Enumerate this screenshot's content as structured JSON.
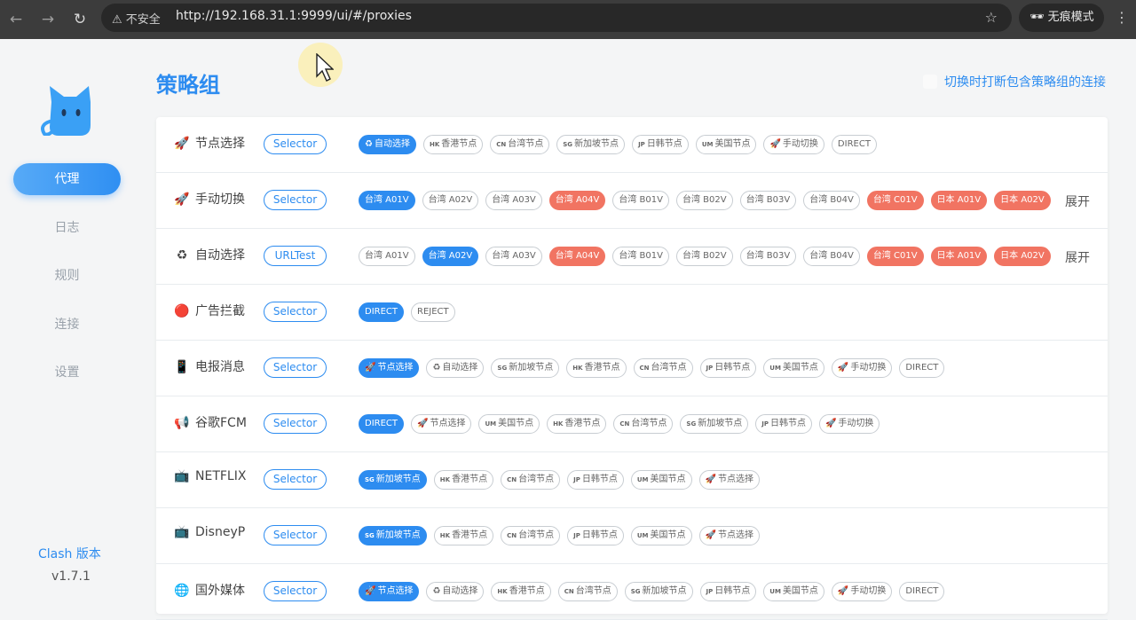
{
  "browser": {
    "security": "不安全",
    "url": "http://192.168.31.1:9999/ui/#/proxies",
    "incognito": "无痕模式"
  },
  "sidebar": {
    "items": [
      {
        "label": "代理"
      },
      {
        "label": "日志"
      },
      {
        "label": "规则"
      },
      {
        "label": "连接"
      },
      {
        "label": "设置"
      }
    ],
    "version_label": "Clash 版本",
    "version": "v1.7.1"
  },
  "page": {
    "title": "策略组",
    "disconnect_option": "切换时打断包含策略组的连接"
  },
  "colors": {
    "accent": "#2d8cf0",
    "timeout": "#f17462"
  },
  "groups": [
    {
      "name": "节点选择",
      "icon": "rocket-icon",
      "type": "Selector",
      "proxies": [
        {
          "label": "自动选择",
          "icon": "recycle-icon",
          "state": "selected"
        },
        {
          "flag": "HK",
          "label": "香港节点"
        },
        {
          "flag": "CN",
          "label": "台湾节点"
        },
        {
          "flag": "SG",
          "label": "新加坡节点"
        },
        {
          "flag": "JP",
          "label": "日韩节点"
        },
        {
          "flag": "UM",
          "label": "美国节点"
        },
        {
          "icon": "rocket-icon",
          "label": "手动切换"
        },
        {
          "label": "DIRECT"
        }
      ]
    },
    {
      "name": "手动切换",
      "icon": "rocket-icon",
      "type": "Selector",
      "expand": "展开",
      "proxies": [
        {
          "label": "台湾 A01V",
          "state": "selected"
        },
        {
          "label": "台湾 A02V"
        },
        {
          "label": "台湾 A03V"
        },
        {
          "label": "台湾 A04V",
          "state": "timeout"
        },
        {
          "label": "台湾 B01V"
        },
        {
          "label": "台湾 B02V"
        },
        {
          "label": "台湾 B03V"
        },
        {
          "label": "台湾 B04V"
        },
        {
          "label": "台湾 C01V",
          "state": "timeout"
        },
        {
          "label": "日本 A01V",
          "state": "timeout"
        },
        {
          "label": "日本 A02V",
          "state": "timeout"
        }
      ]
    },
    {
      "name": "自动选择",
      "icon": "recycle-icon",
      "type": "URLTest",
      "expand": "展开",
      "proxies": [
        {
          "label": "台湾 A01V"
        },
        {
          "label": "台湾 A02V",
          "state": "selected"
        },
        {
          "label": "台湾 A03V"
        },
        {
          "label": "台湾 A04V",
          "state": "timeout"
        },
        {
          "label": "台湾 B01V"
        },
        {
          "label": "台湾 B02V"
        },
        {
          "label": "台湾 B03V"
        },
        {
          "label": "台湾 B04V"
        },
        {
          "label": "台湾 C01V",
          "state": "timeout"
        },
        {
          "label": "日本 A01V",
          "state": "timeout"
        },
        {
          "label": "日本 A02V",
          "state": "timeout"
        }
      ]
    },
    {
      "name": "广告拦截",
      "icon": "stop-icon",
      "type": "Selector",
      "proxies": [
        {
          "label": "DIRECT",
          "state": "selected"
        },
        {
          "label": "REJECT"
        }
      ]
    },
    {
      "name": "电报消息",
      "icon": "phone-icon",
      "type": "Selector",
      "proxies": [
        {
          "icon": "rocket-icon",
          "label": "节点选择",
          "state": "selected"
        },
        {
          "icon": "recycle-icon",
          "label": "自动选择"
        },
        {
          "flag": "SG",
          "label": "新加坡节点"
        },
        {
          "flag": "HK",
          "label": "香港节点"
        },
        {
          "flag": "CN",
          "label": "台湾节点"
        },
        {
          "flag": "JP",
          "label": "日韩节点"
        },
        {
          "flag": "UM",
          "label": "美国节点"
        },
        {
          "icon": "rocket-icon",
          "label": "手动切换"
        },
        {
          "label": "DIRECT"
        }
      ]
    },
    {
      "name": "谷歌FCM",
      "icon": "megaphone-icon",
      "type": "Selector",
      "proxies": [
        {
          "label": "DIRECT",
          "state": "selected"
        },
        {
          "icon": "rocket-icon",
          "label": "节点选择"
        },
        {
          "flag": "UM",
          "label": "美国节点"
        },
        {
          "flag": "HK",
          "label": "香港节点"
        },
        {
          "flag": "CN",
          "label": "台湾节点"
        },
        {
          "flag": "SG",
          "label": "新加坡节点"
        },
        {
          "flag": "JP",
          "label": "日韩节点"
        },
        {
          "icon": "rocket-icon",
          "label": "手动切换"
        }
      ]
    },
    {
      "name": "NETFLIX",
      "icon": "tv-icon",
      "type": "Selector",
      "proxies": [
        {
          "flag": "SG",
          "label": "新加坡节点",
          "state": "selected"
        },
        {
          "flag": "HK",
          "label": "香港节点"
        },
        {
          "flag": "CN",
          "label": "台湾节点"
        },
        {
          "flag": "JP",
          "label": "日韩节点"
        },
        {
          "flag": "UM",
          "label": "美国节点"
        },
        {
          "icon": "rocket-icon",
          "label": "节点选择"
        }
      ]
    },
    {
      "name": "DisneyP",
      "icon": "tv-icon",
      "type": "Selector",
      "proxies": [
        {
          "flag": "SG",
          "label": "新加坡节点",
          "state": "selected"
        },
        {
          "flag": "HK",
          "label": "香港节点"
        },
        {
          "flag": "CN",
          "label": "台湾节点"
        },
        {
          "flag": "JP",
          "label": "日韩节点"
        },
        {
          "flag": "UM",
          "label": "美国节点"
        },
        {
          "icon": "rocket-icon",
          "label": "节点选择"
        }
      ]
    },
    {
      "name": "国外媒体",
      "icon": "globe-icon",
      "type": "Selector",
      "proxies": [
        {
          "icon": "rocket-icon",
          "label": "节点选择",
          "state": "selected"
        },
        {
          "icon": "recycle-icon",
          "label": "自动选择"
        },
        {
          "flag": "HK",
          "label": "香港节点"
        },
        {
          "flag": "CN",
          "label": "台湾节点"
        },
        {
          "flag": "SG",
          "label": "新加坡节点"
        },
        {
          "flag": "JP",
          "label": "日韩节点"
        },
        {
          "flag": "UM",
          "label": "美国节点"
        },
        {
          "icon": "rocket-icon",
          "label": "手动切换"
        },
        {
          "label": "DIRECT"
        }
      ]
    }
  ]
}
